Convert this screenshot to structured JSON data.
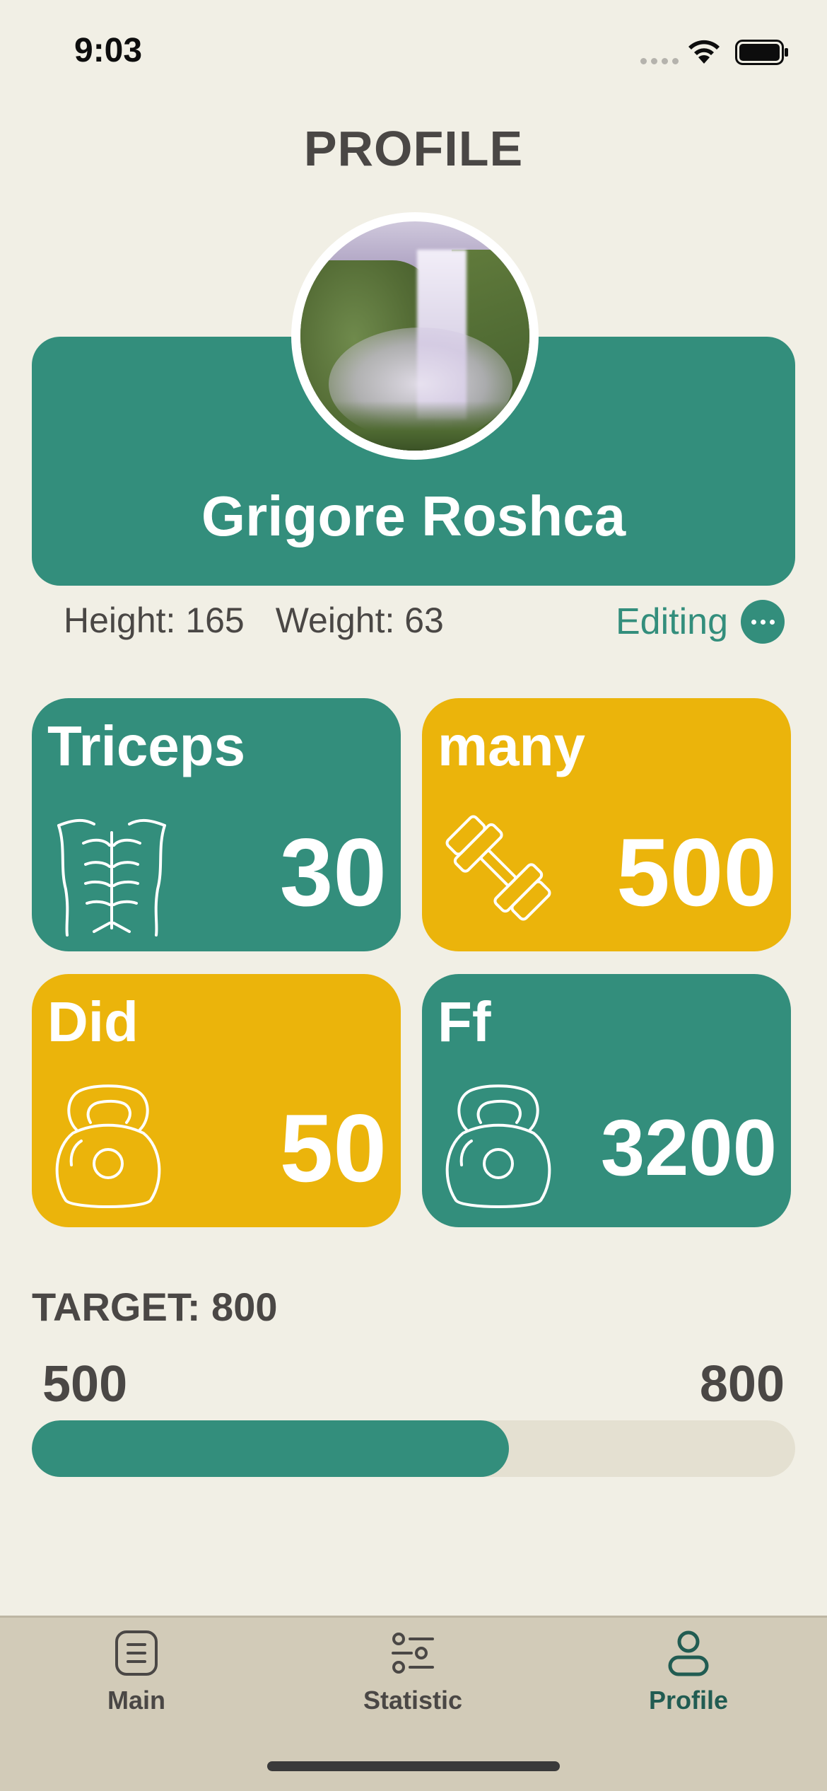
{
  "status_bar": {
    "time": "9:03"
  },
  "page": {
    "title": "PROFILE"
  },
  "profile": {
    "name": "Grigore Roshca",
    "height_text": "Height: 165",
    "weight_text": "Weight: 63",
    "editing_label": "Editing"
  },
  "tiles": [
    {
      "title": "Triceps",
      "value": "30",
      "icon": "abs-icon",
      "color": "#338e7c"
    },
    {
      "title": "many",
      "value": "500",
      "icon": "dumbbell-icon",
      "color": "#ebb40b"
    },
    {
      "title": "Did",
      "value": "50",
      "icon": "kettlebell-icon",
      "color": "#ebb40b"
    },
    {
      "title": "Ff",
      "value": "3200",
      "icon": "kettlebell-icon",
      "color": "#338e7c"
    }
  ],
  "target": {
    "label": "TARGET: 800",
    "current": "500",
    "max": "800",
    "progress_fraction": 0.625
  },
  "tabbar": {
    "tabs": [
      {
        "label": "Main",
        "icon": "list-icon",
        "active": false
      },
      {
        "label": "Statistic",
        "icon": "sliders-icon",
        "active": false
      },
      {
        "label": "Profile",
        "icon": "person-icon",
        "active": true
      }
    ]
  },
  "colors": {
    "accent_green": "#338e7c",
    "accent_yellow": "#ebb40b",
    "background": "#f1efe5",
    "tabbar": "#d2cbb8"
  }
}
